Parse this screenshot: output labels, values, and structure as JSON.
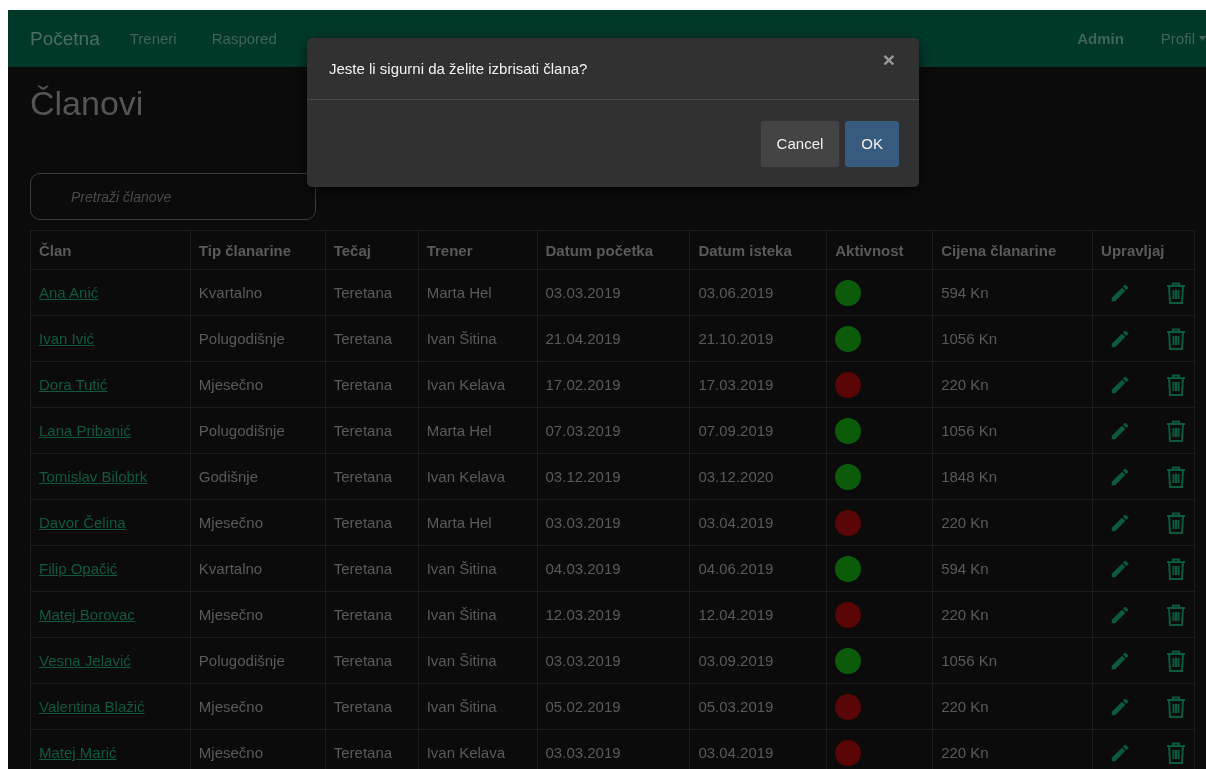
{
  "navbar": {
    "brand": "Početna",
    "links": [
      {
        "label": "Treneri",
        "selected": false
      },
      {
        "label": "Raspored",
        "selected": false
      }
    ],
    "user": "Admin",
    "profile": "Profil"
  },
  "page_title": "Članovi",
  "search": {
    "placeholder": "Pretraži članove"
  },
  "table": {
    "columns": [
      "Član",
      "Tip članarine",
      "Tečaj",
      "Trener",
      "Datum početka",
      "Datum isteka",
      "Aktivnost",
      "Cijena članarine",
      "Upravljaj"
    ],
    "rows": [
      {
        "member": "Ana Anić",
        "type": "Kvartalno",
        "course": "Teretana",
        "trainer": "Marta Hel",
        "start": "03.03.2019",
        "end": "03.06.2019",
        "active": true,
        "price": "594 Kn"
      },
      {
        "member": "Ivan Ivić",
        "type": "Polugodišnje",
        "course": "Teretana",
        "trainer": "Ivan Šitina",
        "start": "21.04.2019",
        "end": "21.10.2019",
        "active": true,
        "price": "1056 Kn"
      },
      {
        "member": "Dora Tutić",
        "type": "Mjesečno",
        "course": "Teretana",
        "trainer": "Ivan Kelava",
        "start": "17.02.2019",
        "end": "17.03.2019",
        "active": false,
        "price": "220 Kn"
      },
      {
        "member": "Lana Pribanić",
        "type": "Polugodišnje",
        "course": "Teretana",
        "trainer": "Marta Hel",
        "start": "07.03.2019",
        "end": "07.09.2019",
        "active": true,
        "price": "1056 Kn"
      },
      {
        "member": "Tomislav Bilobrk",
        "type": "Godišnje",
        "course": "Teretana",
        "trainer": "Ivan Kelava",
        "start": "03.12.2019",
        "end": "03.12.2020",
        "active": true,
        "price": "1848 Kn"
      },
      {
        "member": "Davor Čelina",
        "type": "Mjesečno",
        "course": "Teretana",
        "trainer": "Marta Hel",
        "start": "03.03.2019",
        "end": "03.04.2019",
        "active": false,
        "price": "220 Kn"
      },
      {
        "member": "Filip Opačić",
        "type": "Kvartalno",
        "course": "Teretana",
        "trainer": "Ivan Šitina",
        "start": "04.03.2019",
        "end": "04.06.2019",
        "active": true,
        "price": "594 Kn"
      },
      {
        "member": "Matej Borovac",
        "type": "Mjesečno",
        "course": "Teretana",
        "trainer": "Ivan Šitina",
        "start": "12.03.2019",
        "end": "12.04.2019",
        "active": false,
        "price": "220 Kn"
      },
      {
        "member": "Vesna Jelavić",
        "type": "Polugodišnje",
        "course": "Teretana",
        "trainer": "Ivan Šitina",
        "start": "03.03.2019",
        "end": "03.09.2019",
        "active": true,
        "price": "1056 Kn"
      },
      {
        "member": "Valentina Blažić",
        "type": "Mjesečno",
        "course": "Teretana",
        "trainer": "Ivan Šitina",
        "start": "05.02.2019",
        "end": "05.03.2019",
        "active": false,
        "price": "220 Kn"
      },
      {
        "member": "Matej Marić",
        "type": "Mjesečno",
        "course": "Teretana",
        "trainer": "Ivan Kelava",
        "start": "03.03.2019",
        "end": "03.04.2019",
        "active": false,
        "price": "220 Kn"
      }
    ]
  },
  "modal": {
    "message": "Jeste li sigurni da želite izbrisati člana?",
    "close": "×",
    "buttons": [
      {
        "label": "Cancel",
        "kind": "secondary"
      },
      {
        "label": "OK",
        "kind": "primary"
      }
    ]
  }
}
